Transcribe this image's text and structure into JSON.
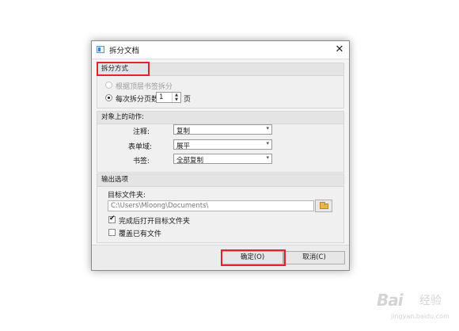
{
  "dialog": {
    "title": "拆分文档",
    "close_glyph": "✕"
  },
  "split_method": {
    "title": "拆分方式",
    "option_bookmark": "根据顶层书签拆分",
    "option_pages_prefix": "每次拆分页数",
    "pages_value": "1",
    "option_pages_suffix": "页"
  },
  "object_actions": {
    "title": "对象上的动作:",
    "rows": [
      {
        "label": "注释:",
        "value": "复制"
      },
      {
        "label": "表单域:",
        "value": "展平"
      },
      {
        "label": "书签:",
        "value": "全部复制"
      }
    ]
  },
  "output": {
    "title": "输出选项",
    "folder_label": "目标文件夹:",
    "folder_path": "C:\\Users\\Mloong\\Documents\\",
    "open_after_label": "完成后打开目标文件夹",
    "open_after_checked": true,
    "overwrite_label": "覆盖已有文件",
    "overwrite_checked": false
  },
  "buttons": {
    "ok": "确定(O)",
    "cancel": "取消(C)"
  },
  "watermark": {
    "brand": "Bai",
    "brand_suffix": "经验",
    "url": "jingyan.baidu.com"
  },
  "colors": {
    "highlight": "#e4222d",
    "dialog_bg": "#f4f4f4"
  },
  "icons": [
    "app-icon",
    "close-icon",
    "spin-arrows-icon",
    "dropdown-caret-icon",
    "folder-icon",
    "check-icon"
  ]
}
